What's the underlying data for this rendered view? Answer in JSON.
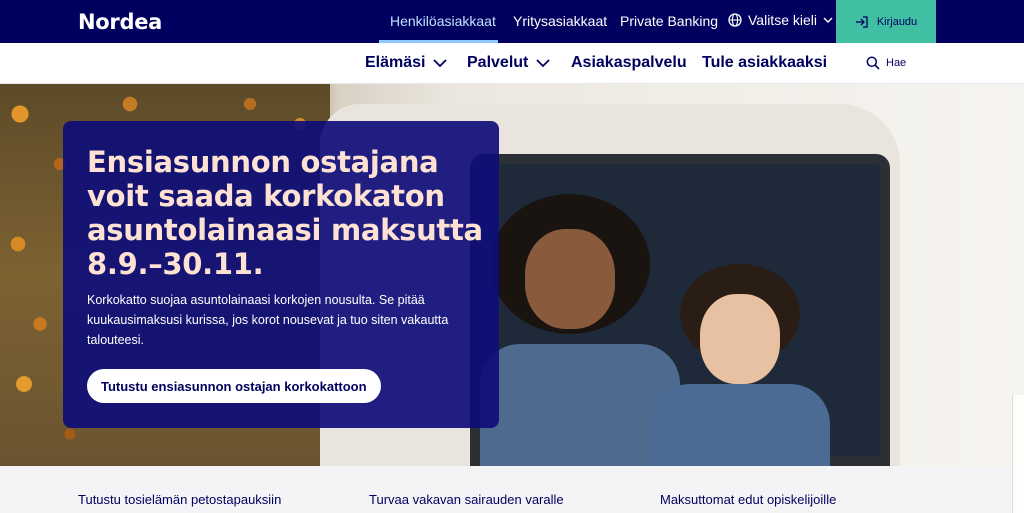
{
  "topbar": {
    "logo": "Nordea",
    "links": [
      "Henkilöasiakkaat",
      "Yritysasiakkaat",
      "Private Banking"
    ],
    "language": "Valitse kieli",
    "login": "Kirjaudu"
  },
  "nav": {
    "items": [
      "Elämäsi",
      "Palvelut",
      "Asiakaspalvelu",
      "Tule asiakkaaksi"
    ],
    "search": "Hae"
  },
  "hero": {
    "title": "Ensiasunnon ostajana voit saada korkokaton asuntolainaasi maksutta 8.9.–30.11.",
    "text": "Korkokatto suojaa asuntolainaasi korkojen nousulta. Se pitää kuukausimaksusi kurissa, jos korot nousevat ja tuo siten vakautta talouteesi.",
    "button": "Tutustu ensiasunnon ostajan korkokattoon"
  },
  "cards": [
    "Tutustu tosielämän petostapauksiin",
    "Turvaa vakavan sairauden varalle",
    "Maksuttomat edut opiskelijoille"
  ],
  "colors": {
    "brand": "#00005e",
    "accent": "#40bfa3",
    "promo_title": "#fde1d3"
  },
  "icons": {
    "language": "globe-icon",
    "login": "login-arrow-icon",
    "search": "search-icon",
    "dropdown": "chevron-down-icon"
  }
}
